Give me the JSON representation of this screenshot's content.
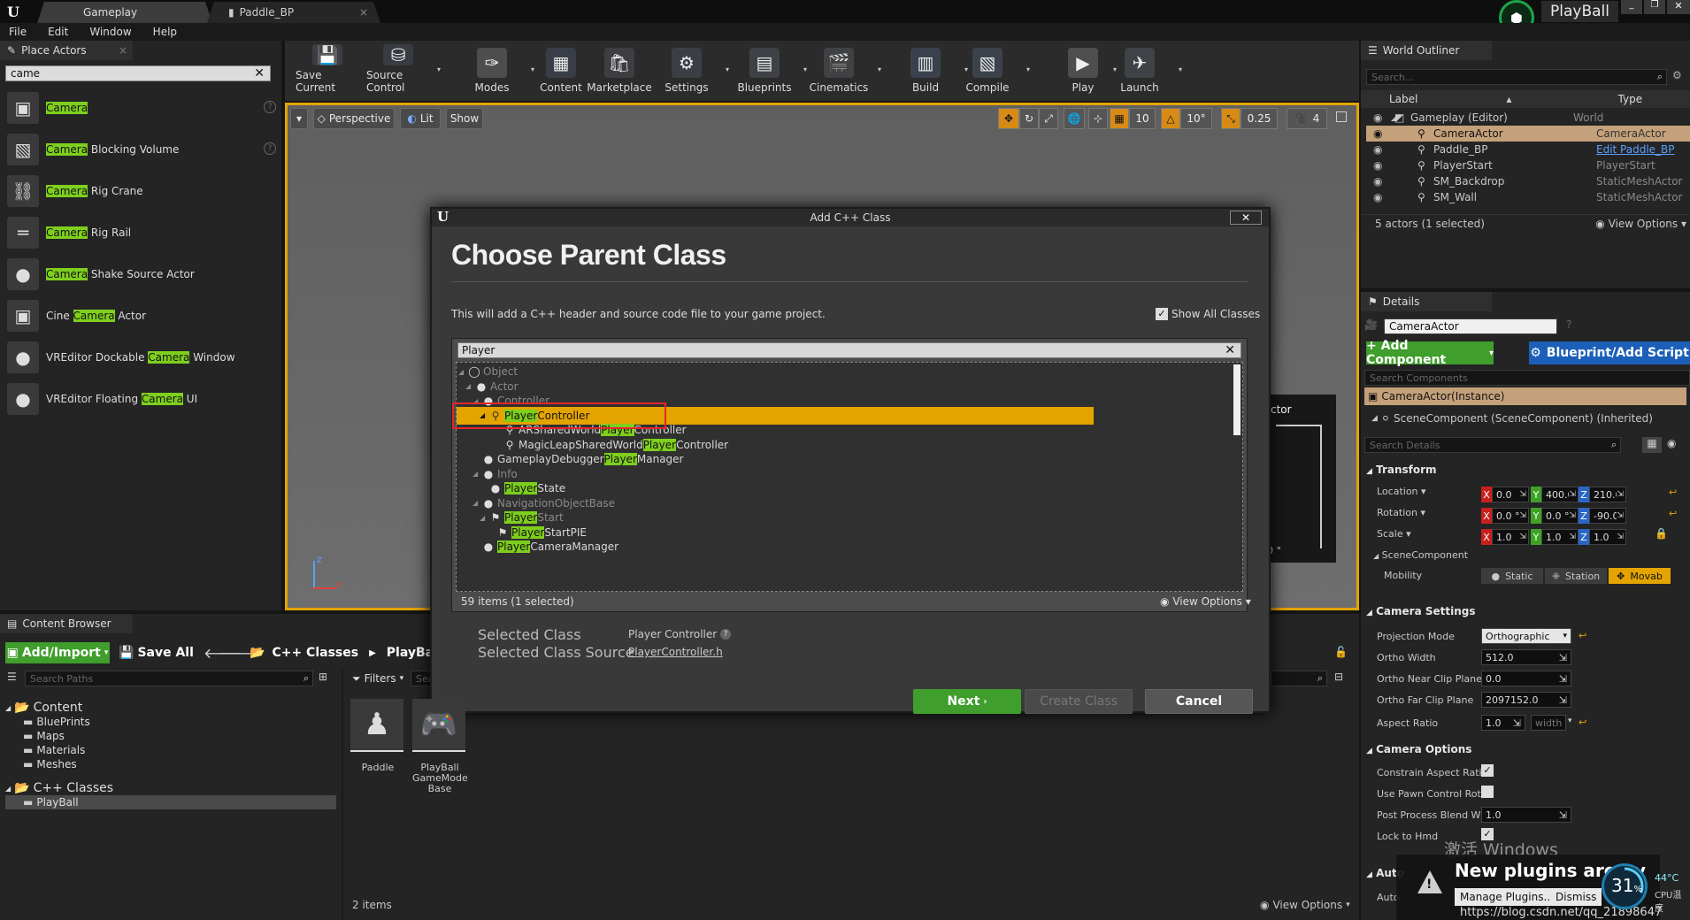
{
  "titlebar": {
    "tabs": [
      {
        "label": "Gameplay"
      },
      {
        "label": "Paddle_BP"
      }
    ],
    "project": "PlayBall",
    "window_controls": [
      "minimize-icon",
      "restore-icon",
      "close-icon"
    ]
  },
  "menu": [
    "File",
    "Edit",
    "Window",
    "Help"
  ],
  "place_actors": {
    "tab": "Place Actors",
    "search_value": "came",
    "items": [
      {
        "pre": "",
        "hl": "Camera",
        "post": ""
      },
      {
        "pre": "",
        "hl": "Camera",
        "post": " Blocking Volume"
      },
      {
        "pre": "",
        "hl": "Camera",
        "post": " Rig Crane"
      },
      {
        "pre": "",
        "hl": "Camera",
        "post": " Rig Rail"
      },
      {
        "pre": "",
        "hl": "Camera",
        "post": " Shake Source Actor"
      },
      {
        "pre": "Cine ",
        "hl": "Camera",
        "post": " Actor"
      },
      {
        "pre": "VREditor Dockable ",
        "hl": "Camera",
        "post": " Window"
      },
      {
        "pre": "VREditor Floating ",
        "hl": "Camera",
        "post": " UI"
      }
    ]
  },
  "toolbar": [
    {
      "label": "Save Current",
      "icon": "save-icon"
    },
    {
      "label": "Source Control",
      "icon": "source-control-icon"
    },
    {
      "label": "Modes",
      "icon": "modes-icon"
    },
    {
      "label": "Content",
      "icon": "content-icon"
    },
    {
      "label": "Marketplace",
      "icon": "marketplace-icon"
    },
    {
      "label": "Settings",
      "icon": "settings-icon"
    },
    {
      "label": "Blueprints",
      "icon": "blueprints-icon"
    },
    {
      "label": "Cinematics",
      "icon": "cinematics-icon"
    },
    {
      "label": "Build",
      "icon": "build-icon"
    },
    {
      "label": "Compile",
      "icon": "compile-icon"
    },
    {
      "label": "Play",
      "icon": "play-icon"
    },
    {
      "label": "Launch",
      "icon": "launch-icon"
    }
  ],
  "viewport": {
    "perspective": "Perspective",
    "lit": "Lit",
    "show": "Show",
    "grid_snap": "10",
    "rotation_snap": "10°",
    "scale_snap": "0.25",
    "camera_speed": "4",
    "partial_text_1": "ctor",
    "partial_text_2": "0 °"
  },
  "outliner": {
    "tab": "World Outliner",
    "search_placeholder": "Search...",
    "col_label": "Label",
    "col_type": "Type",
    "rows": [
      {
        "label": "Gameplay (Editor)",
        "type": "World",
        "indent": 0
      },
      {
        "label": "CameraActor",
        "type": "CameraActor",
        "indent": 1,
        "selected": true
      },
      {
        "label": "Paddle_BP",
        "type": "Edit Paddle_BP",
        "indent": 1,
        "link": true
      },
      {
        "label": "PlayerStart",
        "type": "PlayerStart",
        "indent": 1
      },
      {
        "label": "SM_Backdrop",
        "type": "StaticMeshActor",
        "indent": 1
      },
      {
        "label": "SM_Wall",
        "type": "StaticMeshActor",
        "indent": 1
      }
    ],
    "footer": "5 actors (1 selected)",
    "view_options": "View Options"
  },
  "details": {
    "tab": "Details",
    "name_value": "CameraActor",
    "add_component": "+ Add Component",
    "blueprint_add_script": "Blueprint/Add Script",
    "search_components_placeholder": "Search Components",
    "component_instance": "CameraActor(Instance)",
    "scene_component": "SceneComponent (SceneComponent) (Inherited)",
    "search_details_placeholder": "Search Details",
    "transform": "Transform",
    "location_label": "Location",
    "location": [
      "0.0",
      "400.0",
      "210.0"
    ],
    "rotation_label": "Rotation",
    "rotation": [
      "0.0 °",
      "0.0 °",
      "-90.0 °"
    ],
    "scale_label": "Scale",
    "scale": [
      "1.0",
      "1.0",
      "1.0"
    ],
    "scenecomponent_sub": "SceneComponent",
    "mobility_label": "Mobility",
    "mobility_options": [
      "Static",
      "Station",
      "Movab"
    ],
    "camera_settings": "Camera Settings",
    "projection_mode_label": "Projection Mode",
    "projection_mode": "Orthographic",
    "ortho_width_label": "Ortho Width",
    "ortho_width": "512.0",
    "ortho_near_label": "Ortho Near Clip Plane",
    "ortho_near": "0.0",
    "ortho_far_label": "Ortho Far Clip Plane",
    "ortho_far": "2097152.0",
    "aspect_ratio_label": "Aspect Ratio",
    "aspect_ratio": "1.0",
    "aspect_ratio_extra": "width",
    "camera_options": "Camera Options",
    "constrain_label": "Constrain Aspect Rati",
    "use_pawn_label": "Use Pawn Control Rota",
    "post_process_label": "Post Process Blend W",
    "post_process": "1.0",
    "lock_hmd_label": "Lock to Hmd",
    "auto_1": "Auto",
    "auto_2": "Auto"
  },
  "notification": {
    "watermark": "激活 Windows",
    "title": "New plugins are av",
    "title_tail": "ble",
    "manage": "Manage Plugins...",
    "dismiss": "Dismiss",
    "url": "https://blog.csdn.net/qq_21898647",
    "gauge_pct": "31",
    "gauge_unit": "%",
    "gauge_fraction": 0.31,
    "temp": "44°C",
    "cpu": "CPU温度"
  },
  "dialog": {
    "window_title": "Add C++ Class",
    "heading": "Choose Parent Class",
    "description": "This will add a C++ header and source code file to your game project.",
    "show_all_classes": "Show All Classes",
    "search_value": "Player",
    "tree": [
      {
        "pre": "Object",
        "hl": "",
        "post": "",
        "depth": 0,
        "dim": true,
        "arrow": "◢",
        "icon": "ring"
      },
      {
        "pre": "Actor",
        "hl": "",
        "post": "",
        "depth": 1,
        "dim": true,
        "arrow": "◢",
        "icon": "ball"
      },
      {
        "pre": "Controller",
        "hl": "",
        "post": "",
        "depth": 2,
        "dim": true,
        "arrow": "◢",
        "icon": "ball"
      },
      {
        "pre": "",
        "hl": "Player",
        "post": "Controller",
        "depth": 3,
        "selected": true,
        "arrow": "◢",
        "icon": "figure"
      },
      {
        "pre": "ARSharedWorld",
        "hl": "Player",
        "post": "Controller",
        "depth": 5,
        "icon": "figure"
      },
      {
        "pre": "MagicLeapSharedWorld",
        "hl": "Player",
        "post": "Controller",
        "depth": 5,
        "icon": "figure"
      },
      {
        "pre": "GameplayDebugger",
        "hl": "Player",
        "post": "Manager",
        "depth": 2,
        "icon": "ball"
      },
      {
        "pre": "Info",
        "hl": "",
        "post": "",
        "depth": 2,
        "dim": true,
        "arrow": "◢",
        "icon": "ball"
      },
      {
        "pre": "",
        "hl": "Player",
        "post": "State",
        "depth": 3,
        "icon": "ball"
      },
      {
        "pre": "NavigationObjectBase",
        "hl": "",
        "post": "",
        "depth": 2,
        "dim": true,
        "arrow": "◢",
        "icon": "ball"
      },
      {
        "pre": "",
        "hl": "Player",
        "post": "Start",
        "depth": 3,
        "dim": true,
        "arrow": "◢",
        "icon": "flag"
      },
      {
        "pre": "",
        "hl": "Player",
        "post": "StartPIE",
        "depth": 4,
        "icon": "flag"
      },
      {
        "pre": "",
        "hl": "Player",
        "post": "CameraManager",
        "depth": 2,
        "icon": "ball"
      }
    ],
    "items_count": "59 items (1 selected)",
    "view_options": "View Options",
    "selected_class_label": "Selected Class",
    "selected_class_value": "Player Controller",
    "selected_source_label": "Selected Class Source",
    "selected_source_value": "PlayerController.h",
    "next": "Next",
    "create_class": "Create Class",
    "cancel": "Cancel"
  },
  "content_browser": {
    "tab": "Content Browser",
    "add_import": "Add/Import",
    "save_all": "Save All",
    "path": [
      "C++ Classes",
      "PlayBall"
    ],
    "search_paths_placeholder": "Search Paths",
    "filters": "Filters",
    "search_placeholder": "Sea",
    "tree": [
      {
        "label": "Content",
        "depth": 0,
        "root": true
      },
      {
        "label": "BluePrints",
        "depth": 1
      },
      {
        "label": "Maps",
        "depth": 1
      },
      {
        "label": "Materials",
        "depth": 1
      },
      {
        "label": "Meshes",
        "depth": 1
      },
      {
        "label": "C++ Classes",
        "depth": 0,
        "root": true
      },
      {
        "label": "PlayBall",
        "depth": 1,
        "selected": true
      }
    ],
    "assets": [
      {
        "label": "Paddle"
      },
      {
        "label": "PlayBall\nGameMode\nBase"
      }
    ],
    "items_count": "2 items",
    "view_options": "View Options"
  },
  "colors": {
    "accent_orange": "#e4a400",
    "highlight_green": "#7ecf1d",
    "button_green": "#3f9e2c",
    "button_blue": "#1c5fb8",
    "red_box": "#e3262b"
  }
}
